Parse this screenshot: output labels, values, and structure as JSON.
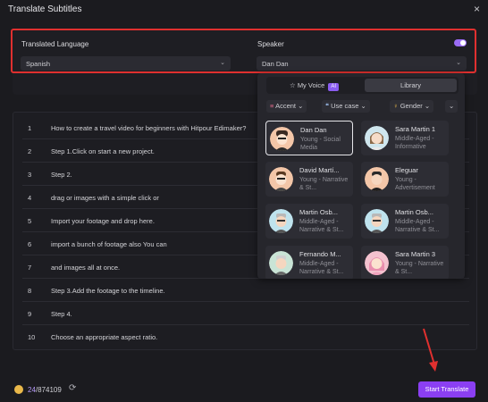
{
  "window": {
    "title": "Translate Subtitles",
    "close_glyph": "×"
  },
  "translated_language": {
    "label": "Translated Language",
    "value": "Spanish"
  },
  "speaker": {
    "label": "Speaker",
    "value": "Dan Dan",
    "toggle_on": true
  },
  "voice_panel": {
    "tabs": [
      {
        "label": "My Voice",
        "badge": "AI",
        "active": false
      },
      {
        "label": "Library",
        "active": true
      }
    ],
    "filters": [
      {
        "label": "Accent",
        "icon": "accent-icon"
      },
      {
        "label": "Use case",
        "icon": "quote-icon"
      },
      {
        "label": "Gender",
        "icon": "gender-icon"
      },
      {
        "label": "",
        "icon": "chevron-down-icon"
      }
    ],
    "voices": [
      {
        "name": "Dan Dan",
        "desc": "Young - Social Media",
        "selected": true
      },
      {
        "name": "Sara Martin 1",
        "desc": "Middle-Aged - Informative"
      },
      {
        "name": "David Martí...",
        "desc": "Young - Narrative & St..."
      },
      {
        "name": "Eleguar",
        "desc": "Young - Advertisement"
      },
      {
        "name": "Martin Osb...",
        "desc": "Middle-Aged - Narrative & St..."
      },
      {
        "name": "Martin Osb...",
        "desc": "Middle-Aged - Narrative & St..."
      },
      {
        "name": "Fernando M...",
        "desc": "Middle-Aged - Narrative & St..."
      },
      {
        "name": "Sara Martin 3",
        "desc": "Young - Narrative & St..."
      }
    ]
  },
  "subtitles": [
    {
      "num": "1",
      "text": "How to create a travel video for beginners with Hitpour Edimaker?"
    },
    {
      "num": "2",
      "text": "Step 1.Click on start a new project."
    },
    {
      "num": "3",
      "text": "Step 2."
    },
    {
      "num": "4",
      "text": "drag or images with a simple click or"
    },
    {
      "num": "5",
      "text": "Import your footage and drop here."
    },
    {
      "num": "6",
      "text": "import a bunch of footage also You can"
    },
    {
      "num": "7",
      "text": "and images all at once."
    },
    {
      "num": "8",
      "text": "Step 3.Add the footage to the timeline."
    },
    {
      "num": "9",
      "text": "Step 4."
    },
    {
      "num": "10",
      "text": "Choose an appropriate aspect ratio."
    }
  ],
  "footer": {
    "credits_used": "24",
    "credits_total": "/874109",
    "start_label": "Start Translate"
  },
  "colors": {
    "accent": "#8b3ff2",
    "highlight": "#e0302f",
    "toggle": "#9a6cf5"
  }
}
